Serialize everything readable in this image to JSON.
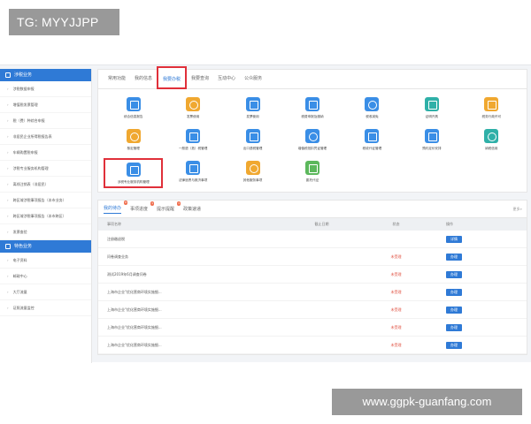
{
  "watermark_top": "TG: MYYJJPP",
  "watermark_bottom": "www.ggpk-guanfang.com",
  "sidebar": {
    "section1": "涉税业务",
    "items": [
      "涉税数据申报",
      "增值税发票管理",
      "税（费）种综合申报",
      "非居民企业所得税报告表",
      "车辆购置税申报",
      "涉税专业服务机构管理",
      "离线注销表（非居民）",
      "跨区域涉税事项报告（本市业务）",
      "跨区域涉税事项报告（本市跨区）",
      "发票查验"
    ],
    "section2": "特色业务",
    "items2": [
      "电子资料",
      "邮政中心",
      "大厅流量",
      "证照流量监控"
    ]
  },
  "top_tabs": [
    "常用功能",
    "我的信息",
    "我要办税",
    "我要查询",
    "互动中心",
    "公众服务"
  ],
  "active_tab": "我要办税",
  "tiles": [
    {
      "label": "综合信息报告",
      "color": "b"
    },
    {
      "label": "发票使用",
      "color": "o"
    },
    {
      "label": "发票使用",
      "color": "b"
    },
    {
      "label": "税费申报及缴纳",
      "color": "b"
    },
    {
      "label": "税收减免",
      "color": "b"
    },
    {
      "label": "证明开具",
      "color": "t"
    },
    {
      "label": "税务行政许可",
      "color": "o"
    },
    {
      "label": "核定管理",
      "color": "o"
    },
    {
      "label": "一般退（抵）税管理",
      "color": "b"
    },
    {
      "label": "出口退税管理",
      "color": "b"
    },
    {
      "label": "增值税抵扣凭证管理",
      "color": "b"
    },
    {
      "label": "税收代征管理",
      "color": "b"
    },
    {
      "label": "预约定价安排",
      "color": "b"
    },
    {
      "label": "纳税信用",
      "color": "t"
    },
    {
      "label": "涉税专业服务机构管理",
      "color": "b"
    },
    {
      "label": "法律追责与救济事项",
      "color": "b"
    },
    {
      "label": "其他服务事项",
      "color": "o"
    },
    {
      "label": "委托代征",
      "color": "g"
    }
  ],
  "highlight_tile_index": 14,
  "bottom_tabs": [
    {
      "label": "我的待办",
      "badge": "6"
    },
    {
      "label": "事项进度",
      "badge": "1"
    },
    {
      "label": "提示提醒",
      "badge": "1"
    },
    {
      "label": "政策速递",
      "badge": ""
    }
  ],
  "more_label": "更多»",
  "table": {
    "headers": [
      "事项名称",
      "截止日期",
      "状态",
      "操作"
    ],
    "rows": [
      {
        "name": "注册缴退税",
        "date": "",
        "status": "",
        "action": "详情"
      },
      {
        "name": "问卷调查业务",
        "date": "",
        "status": "未受理",
        "action": "办理"
      },
      {
        "name": "测试2019年6月调查问卷",
        "date": "",
        "status": "未受理",
        "action": "办理"
      },
      {
        "name": "上海市企业\"优化营商环境实施细...",
        "date": "",
        "status": "未受理",
        "action": "办理"
      },
      {
        "name": "上海市企业\"优化营商环境实施细...",
        "date": "",
        "status": "未受理",
        "action": "办理"
      },
      {
        "name": "上海市企业\"优化营商环境实施细...",
        "date": "",
        "status": "未受理",
        "action": "办理"
      },
      {
        "name": "上海市企业\"优化营商环境实施细...",
        "date": "",
        "status": "未受理",
        "action": "办理"
      }
    ]
  }
}
